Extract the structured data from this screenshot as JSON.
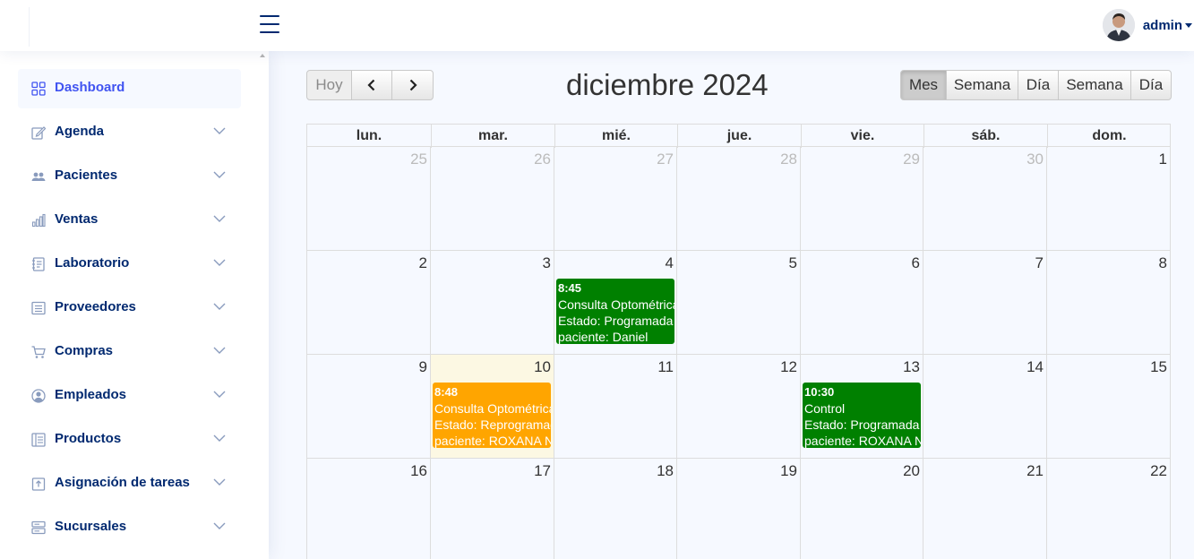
{
  "header": {
    "user": {
      "name": "admin"
    }
  },
  "sidebar": {
    "items": [
      {
        "label": "Dashboard",
        "icon": "grid-icon",
        "active": true
      },
      {
        "label": "Agenda",
        "icon": "pencil-square-icon"
      },
      {
        "label": "Pacientes",
        "icon": "people-icon"
      },
      {
        "label": "Ventas",
        "icon": "bar-chart-icon"
      },
      {
        "label": "Laboratorio",
        "icon": "journal-text-icon"
      },
      {
        "label": "Proveedores",
        "icon": "card-list-icon"
      },
      {
        "label": "Compras",
        "icon": "cart-icon"
      },
      {
        "label": "Empleados",
        "icon": "person-circle-icon"
      },
      {
        "label": "Productos",
        "icon": "layout-text-icon"
      },
      {
        "label": "Asignación de tareas",
        "icon": "box-arrow-up-icon"
      },
      {
        "label": "Sucursales",
        "icon": "server-icon"
      }
    ]
  },
  "calendar": {
    "title": "diciembre 2024",
    "today_label": "Hoy",
    "views": [
      {
        "label": "Mes",
        "active": true
      },
      {
        "label": "Semana"
      },
      {
        "label": "Día"
      },
      {
        "label": "Semana"
      },
      {
        "label": "Día"
      }
    ],
    "weekdays": [
      "lun.",
      "mar.",
      "mié.",
      "jue.",
      "vie.",
      "sáb.",
      "dom."
    ],
    "weeks": [
      [
        {
          "day": "25",
          "other": true
        },
        {
          "day": "26",
          "other": true
        },
        {
          "day": "27",
          "other": true
        },
        {
          "day": "28",
          "other": true
        },
        {
          "day": "29",
          "other": true
        },
        {
          "day": "30",
          "other": true
        },
        {
          "day": "1"
        }
      ],
      [
        {
          "day": "2"
        },
        {
          "day": "3"
        },
        {
          "day": "4"
        },
        {
          "day": "5"
        },
        {
          "day": "6"
        },
        {
          "day": "7"
        },
        {
          "day": "8"
        }
      ],
      [
        {
          "day": "9"
        },
        {
          "day": "10",
          "today": true
        },
        {
          "day": "11"
        },
        {
          "day": "12"
        },
        {
          "day": "13"
        },
        {
          "day": "14"
        },
        {
          "day": "15"
        }
      ],
      [
        {
          "day": "16"
        },
        {
          "day": "17"
        },
        {
          "day": "18"
        },
        {
          "day": "19"
        },
        {
          "day": "20"
        },
        {
          "day": "21"
        },
        {
          "day": "22"
        }
      ]
    ],
    "events": [
      {
        "week": 1,
        "weekday": 2,
        "time": "8:45",
        "title": "Consulta Optométrica",
        "estado": "Estado: Programada",
        "paciente": "paciente: Daniel",
        "color": "#008000"
      },
      {
        "week": 2,
        "weekday": 1,
        "time": "8:48",
        "title": "Consulta Optométrica",
        "estado": "Estado: Reprogramada",
        "paciente": "paciente: ROXANA N",
        "color": "#ffa500"
      },
      {
        "week": 2,
        "weekday": 4,
        "time": "10:30",
        "title": "Control",
        "estado": "Estado: Programada",
        "paciente": "paciente: ROXANA N",
        "color": "#008000"
      }
    ],
    "colors": {
      "today_bg": "#fcf8e3",
      "accent": "#4154f1",
      "nav_text": "#012970"
    }
  }
}
